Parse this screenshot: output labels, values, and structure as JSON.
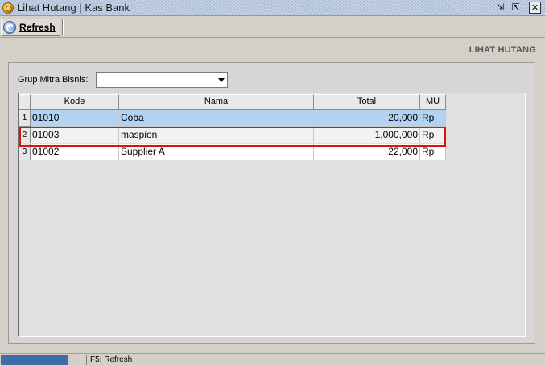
{
  "window": {
    "title": "Lihat Hutang | Kas Bank"
  },
  "icons": {
    "app": "coin-icon",
    "refresh": "refresh-icon",
    "restore": "restore-down-icon",
    "maximize": "maximize-icon",
    "close": "close-icon"
  },
  "toolbar": {
    "refresh_label": "Refresh"
  },
  "header": {
    "page_title": "LIHAT HUTANG"
  },
  "filter": {
    "label": "Grup Mitra Bisnis:",
    "value": ""
  },
  "grid": {
    "columns": [
      "Kode",
      "Nama",
      "Total",
      "MU"
    ],
    "rows": [
      {
        "no": "1",
        "kode": "01010",
        "nama": "Coba",
        "total": "20,000",
        "mu": "Rp"
      },
      {
        "no": "2",
        "kode": "01003",
        "nama": "maspion",
        "total": "1,000,000",
        "mu": "Rp"
      },
      {
        "no": "3",
        "kode": "01002",
        "nama": "Supplier A",
        "total": "22,000",
        "mu": "Rp"
      }
    ],
    "selected_row": 0,
    "highlighted_row": 1
  },
  "statusbar": {
    "hint": "F5: Refresh"
  },
  "colors": {
    "selection": "#b3d3f3",
    "highlight_border": "#dd1111",
    "status_progress": "#3d6ea8"
  }
}
